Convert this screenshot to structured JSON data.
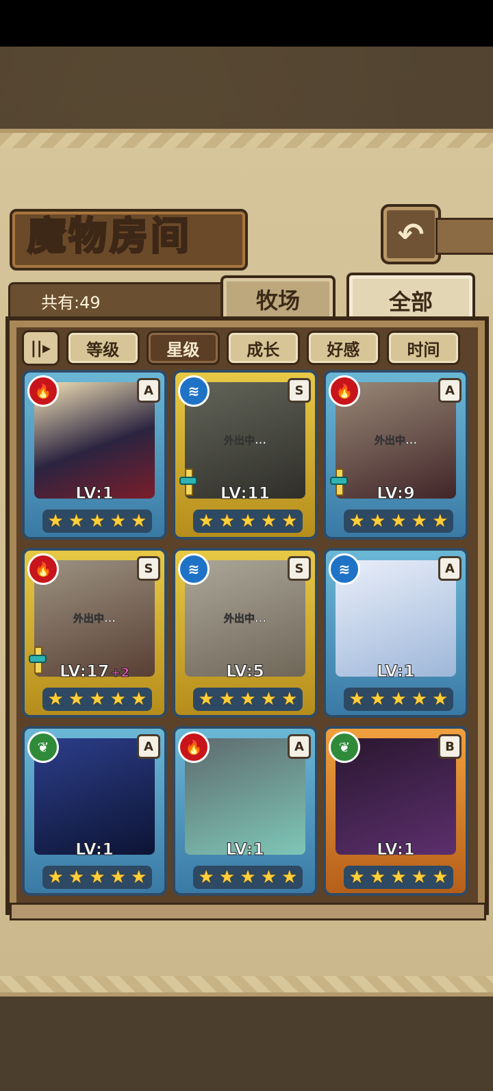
{
  "header": {
    "title": "魔物房间",
    "back_icon": "↶"
  },
  "summary": {
    "count_label": "共有:49"
  },
  "tabs": [
    {
      "label": "牧场",
      "active": false
    },
    {
      "label": "全部",
      "active": true
    }
  ],
  "sort": {
    "toggle_icon": "||▸",
    "options": [
      {
        "label": "等级",
        "selected": false
      },
      {
        "label": "星级",
        "selected": true
      },
      {
        "label": "成长",
        "selected": false
      },
      {
        "label": "好感",
        "selected": false
      },
      {
        "label": "时间",
        "selected": false
      }
    ]
  },
  "monsters": [
    {
      "element": "fire",
      "rank": "A",
      "level": "LV:1",
      "plus": "",
      "status": "",
      "frame": "blue",
      "stars": 5,
      "weapon": false
    },
    {
      "element": "water",
      "rank": "S",
      "level": "LV:11",
      "plus": "",
      "status": "外出中...",
      "frame": "gold",
      "stars": 5,
      "weapon": true
    },
    {
      "element": "fire",
      "rank": "A",
      "level": "LV:9",
      "plus": "",
      "status": "外出中...",
      "frame": "blue",
      "stars": 5,
      "weapon": true
    },
    {
      "element": "fire",
      "rank": "S",
      "level": "LV:17",
      "plus": "+2",
      "status": "外出中...",
      "frame": "gold",
      "stars": 5,
      "weapon": true
    },
    {
      "element": "water",
      "rank": "S",
      "level": "LV:5",
      "plus": "",
      "status": "外出中...",
      "frame": "gold",
      "stars": 5,
      "weapon": false
    },
    {
      "element": "water",
      "rank": "A",
      "level": "LV:1",
      "plus": "",
      "status": "",
      "frame": "blue",
      "stars": 5,
      "weapon": false
    },
    {
      "element": "leaf",
      "rank": "A",
      "level": "LV:1",
      "plus": "",
      "status": "",
      "frame": "blue",
      "stars": 5,
      "weapon": false
    },
    {
      "element": "fire",
      "rank": "A",
      "level": "LV:1",
      "plus": "",
      "status": "",
      "frame": "blue",
      "stars": 5,
      "weapon": false
    },
    {
      "element": "leaf",
      "rank": "B",
      "level": "LV:1",
      "plus": "",
      "status": "",
      "frame": "orange",
      "stars": 5,
      "weapon": false
    }
  ],
  "colors": {
    "fire": "#c8141b",
    "water": "#1f73c7",
    "leaf": "#2f8b3a",
    "star": "#ffcf3a",
    "plus": "#ff5ec6"
  }
}
